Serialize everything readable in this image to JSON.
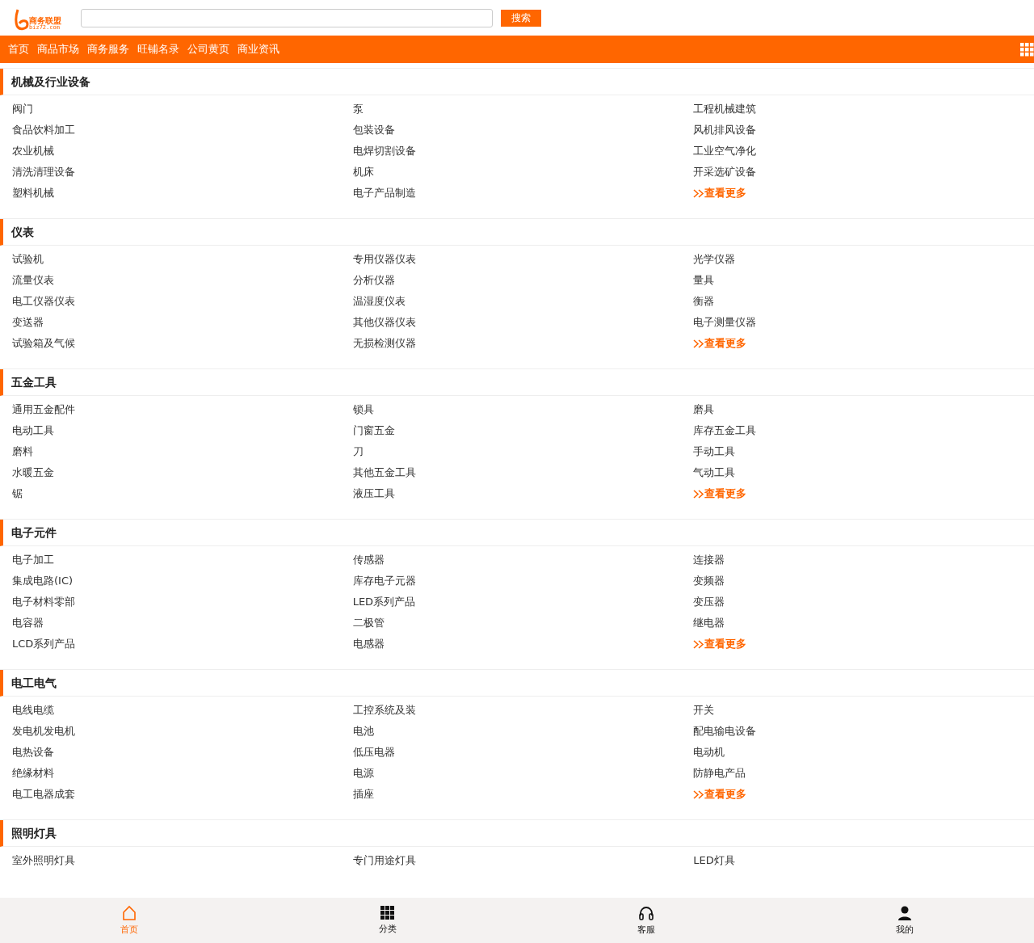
{
  "logo": {
    "name": "商务联盟",
    "domain": "biz72.com"
  },
  "search": {
    "button": "搜索"
  },
  "nav": [
    "首页",
    "商品市场",
    "商务服务",
    "旺铺名录",
    "公司黄页",
    "商业资讯"
  ],
  "sections": [
    {
      "title": "机械及行业设备",
      "items": [
        "阀门",
        "泵",
        "工程机械建筑",
        "食品饮料加工",
        "包装设备",
        "风机排风设备",
        "农业机械",
        "电焊切割设备",
        "工业空气净化",
        "清洗清理设备",
        "机床",
        "开采选矿设备",
        "塑料机械",
        "电子产品制造"
      ],
      "more": "查看更多"
    },
    {
      "title": "仪表",
      "items": [
        "试验机",
        "专用仪器仪表",
        "光学仪器",
        "流量仪表",
        "分析仪器",
        "量具",
        "电工仪器仪表",
        "温湿度仪表",
        "衡器",
        "变送器",
        "其他仪器仪表",
        "电子测量仪器",
        "试验箱及气候",
        "无损检测仪器"
      ],
      "more": "查看更多"
    },
    {
      "title": "五金工具",
      "items": [
        "通用五金配件",
        "锁具",
        "磨具",
        "电动工具",
        "门窗五金",
        "库存五金工具",
        "磨料",
        "刀",
        "手动工具",
        "水暖五金",
        "其他五金工具",
        "气动工具",
        "锯",
        "液压工具"
      ],
      "more": "查看更多"
    },
    {
      "title": "电子元件",
      "items": [
        "电子加工",
        "传感器",
        "连接器",
        "集成电路(IC)",
        "库存电子元器",
        "变频器",
        "电子材料零部",
        "LED系列产品",
        "变压器",
        "电容器",
        "二极管",
        "继电器",
        "LCD系列产品",
        "电感器"
      ],
      "more": "查看更多"
    },
    {
      "title": "电工电气",
      "items": [
        "电线电缆",
        "工控系统及装",
        "开关",
        "发电机发电机",
        "电池",
        "配电输电设备",
        "电热设备",
        "低压电器",
        "电动机",
        "绝缘材料",
        "电源",
        "防静电产品",
        "电工电器成套",
        "插座"
      ],
      "more": "查看更多"
    },
    {
      "title": "照明灯具",
      "items": [
        "室外照明灯具",
        "专门用途灯具",
        "LED灯具"
      ]
    }
  ],
  "tabbar": [
    {
      "label": "首页",
      "kind": "home",
      "selected": true
    },
    {
      "label": "分类",
      "kind": "grid",
      "selected": false
    },
    {
      "label": "客服",
      "kind": "headset",
      "selected": false
    },
    {
      "label": "我的",
      "kind": "user",
      "selected": false
    }
  ]
}
